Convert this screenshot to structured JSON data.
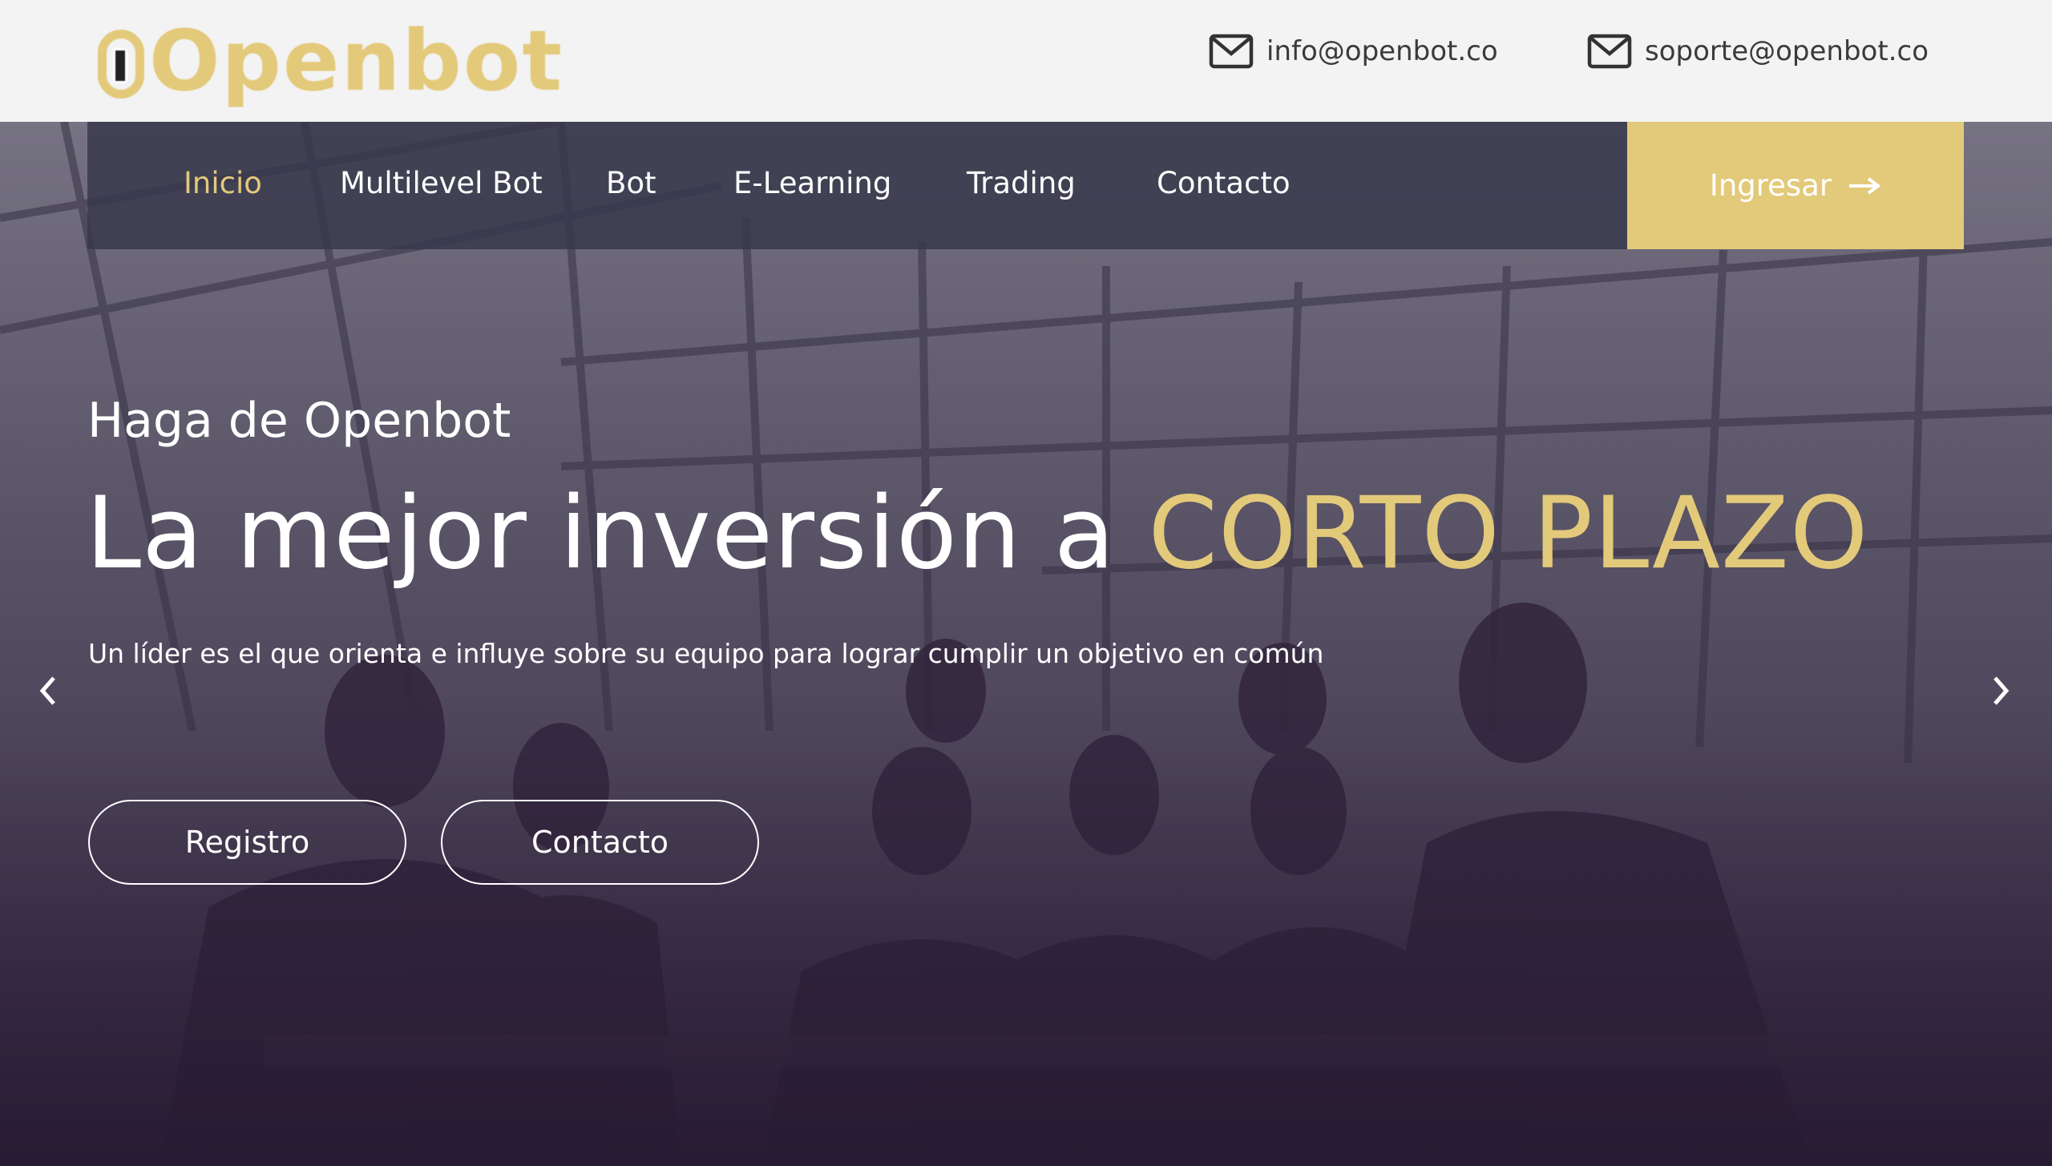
{
  "brand": {
    "name": "Openbot",
    "accent_color": "#e3c97a"
  },
  "header": {
    "contacts": [
      {
        "icon": "envelope-icon",
        "email": "info@openbot.co"
      },
      {
        "icon": "envelope-icon",
        "email": "soporte@openbot.co"
      }
    ]
  },
  "nav": {
    "items": [
      {
        "label": "Inicio",
        "active": true
      },
      {
        "label": "Multilevel Bot",
        "active": false
      },
      {
        "label": "Bot",
        "active": false
      },
      {
        "label": "E-Learning",
        "active": false
      },
      {
        "label": "Trading",
        "active": false
      },
      {
        "label": "Contacto",
        "active": false
      }
    ],
    "login_label": "Ingresar",
    "login_icon": "arrow-right-icon"
  },
  "hero": {
    "kicker": "Haga de Openbot",
    "headline_main": "La mejor inversión a ",
    "headline_accent": "CORTO PLAZO",
    "subline": "Un líder es el que orienta e influye sobre su equipo para lograr cumplir un objetivo en común",
    "buttons": [
      {
        "label": "Registro"
      },
      {
        "label": "Contacto"
      }
    ],
    "prev_icon": "chevron-left-icon",
    "next_icon": "chevron-right-icon"
  }
}
